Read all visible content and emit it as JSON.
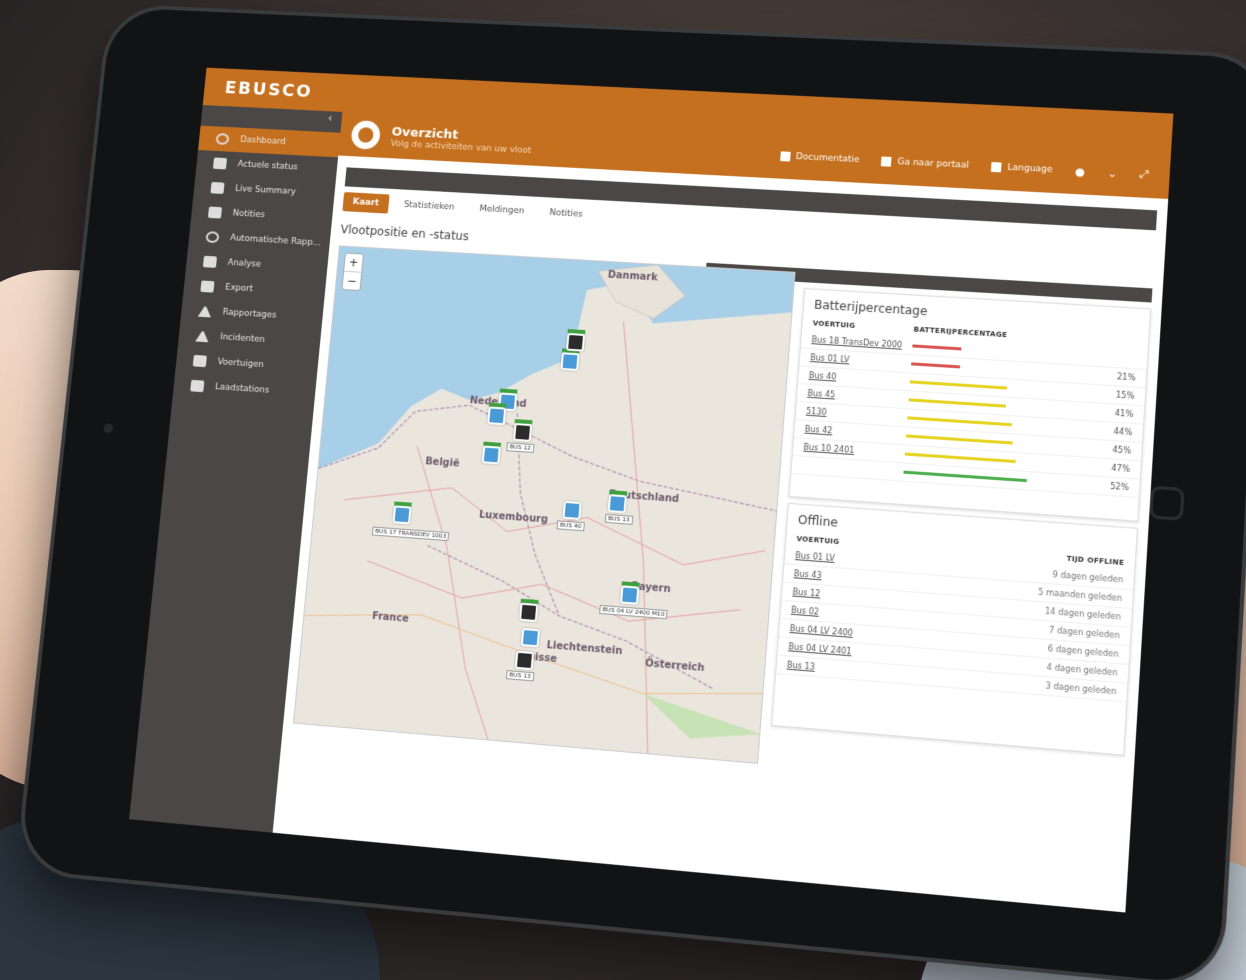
{
  "brand": {
    "name": "EBUSCO",
    "accent": "#c4701f",
    "sidebar_bg": "#4a4746"
  },
  "sidebar": {
    "collapse_icon": "chevron-left-icon",
    "items": [
      {
        "label": "Dashboard",
        "icon": "dashboard-icon",
        "active": true
      },
      {
        "label": "Actuele status",
        "icon": "map-icon"
      },
      {
        "label": "Live Summary",
        "icon": "map-icon"
      },
      {
        "label": "Notities",
        "icon": "note-icon"
      },
      {
        "label": "Automatische Rapp...",
        "icon": "clock-icon"
      },
      {
        "label": "Analyse",
        "icon": "chart-icon"
      },
      {
        "label": "Export",
        "icon": "export-icon"
      },
      {
        "label": "Rapportages",
        "icon": "report-icon"
      },
      {
        "label": "Incidenten",
        "icon": "warning-icon"
      },
      {
        "label": "Voertuigen",
        "icon": "bus-icon"
      },
      {
        "label": "Laadstations",
        "icon": "charger-icon"
      }
    ]
  },
  "header": {
    "title": "Overzicht",
    "subtitle": "Volg de activiteiten van uw vloot",
    "actions": [
      {
        "label": "Documentatie",
        "icon": "book-icon"
      },
      {
        "label": "Ga naar portaal",
        "icon": "portal-icon"
      },
      {
        "label": "Language",
        "icon": "language-icon"
      }
    ],
    "user_icon": "user-icon",
    "dropdown_icon": "chevron-down-icon",
    "fullscreen_icon": "expand-icon"
  },
  "tabs": [
    {
      "label": "Kaart",
      "active": true
    },
    {
      "label": "Statistieken"
    },
    {
      "label": "Meldingen"
    },
    {
      "label": "Notities"
    }
  ],
  "section_title": "Vlootpositie en -status",
  "map": {
    "zoom_in": "+",
    "zoom_out": "−",
    "labels": {
      "danmark": "Danmark",
      "nederland": "Nederland",
      "belgie": "België",
      "luxembourg": "Luxembourg",
      "deutschland": "Deutschland",
      "france": "France",
      "liechtenstein": "Liechtenstein",
      "suisse": "Suisse",
      "osterreich": "Österreich",
      "bayern": "Bayern"
    },
    "marker_tags": {
      "m1": "BUS 17 TRANSDEV 1003",
      "m2": "BUS 12",
      "m3": "BUS 40",
      "m4": "BUS 13",
      "m5": "BUS 04 LV 2400 M10",
      "m6": "BUS 13"
    }
  },
  "battery": {
    "title": "Batterijpercentage",
    "col_vehicle": "VOERTUIG",
    "col_battery": "BATTERIJPERCENTAGE",
    "rows": [
      {
        "vehicle": "Bus 18 TransDev 2000",
        "percent": 21,
        "pct_label": "",
        "color": "#d9534f"
      },
      {
        "vehicle": "Bus 01 LV",
        "percent": 21,
        "pct_label": "21%",
        "color": "#d9534f"
      },
      {
        "vehicle": "Bus 40",
        "percent": 41,
        "pct_label": "15%",
        "color": "#e5d31f"
      },
      {
        "vehicle": "Bus 45",
        "percent": 41,
        "pct_label": "41%",
        "color": "#e5d31f"
      },
      {
        "vehicle": "5130",
        "percent": 44,
        "pct_label": "44%",
        "color": "#e5d31f"
      },
      {
        "vehicle": "Bus 42",
        "percent": 45,
        "pct_label": "45%",
        "color": "#e5d31f"
      },
      {
        "vehicle": "Bus 10 2401",
        "percent": 47,
        "pct_label": "47%",
        "color": "#e5d31f"
      },
      {
        "vehicle": "",
        "percent": 52,
        "pct_label": "52%",
        "color": "#4cae4c"
      }
    ]
  },
  "offline": {
    "title": "Offline",
    "col_vehicle": "VOERTUIG",
    "col_time": "TIJD OFFLINE",
    "rows": [
      {
        "vehicle": "Bus 01 LV",
        "ago": "9 dagen geleden"
      },
      {
        "vehicle": "Bus 43",
        "ago": "5 maanden geleden"
      },
      {
        "vehicle": "Bus 12",
        "ago": "14 dagen geleden"
      },
      {
        "vehicle": "Bus 02",
        "ago": "7 dagen geleden"
      },
      {
        "vehicle": "Bus 04 LV 2400",
        "ago": "6 dagen geleden"
      },
      {
        "vehicle": "Bus 04 LV 2401",
        "ago": "4 dagen geleden"
      },
      {
        "vehicle": "Bus 13",
        "ago": "3 dagen geleden"
      }
    ]
  }
}
